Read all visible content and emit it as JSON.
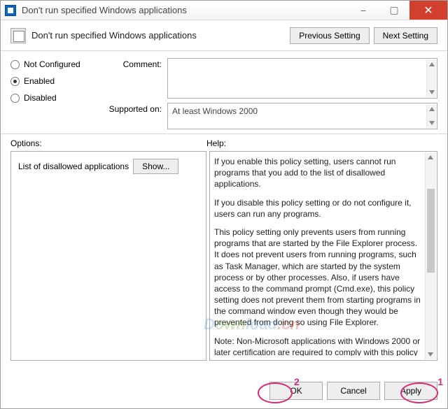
{
  "window": {
    "title": "Don't run specified Windows applications",
    "controls": {
      "min": "−",
      "max": "▢",
      "close": "✕"
    }
  },
  "header": {
    "title": "Don't run specified Windows applications",
    "prev": "Previous Setting",
    "next": "Next Setting"
  },
  "radios": {
    "notConfigured": "Not Configured",
    "enabled": "Enabled",
    "disabled": "Disabled",
    "selected": "enabled"
  },
  "mid": {
    "commentLabel": "Comment:",
    "supportedLabel": "Supported on:",
    "supportedText": "At least Windows 2000"
  },
  "labels": {
    "options": "Options:",
    "help": "Help:"
  },
  "options": {
    "listLabel": "List of disallowed applications",
    "showBtn": "Show..."
  },
  "help": {
    "p1": "If you enable this policy setting, users cannot run programs that you add to the list of disallowed applications.",
    "p2": "If you disable this policy setting or do not configure it, users can run any programs.",
    "p3": "This policy setting only prevents users from running programs that are started by the File Explorer process. It does not prevent users from running programs, such as Task Manager, which are started by the system process or by other processes.  Also, if users have access to the command prompt (Cmd.exe), this policy setting does not prevent them from starting programs in the command window even though they would be prevented from doing so using File Explorer.",
    "p4": "Note: Non-Microsoft applications with Windows 2000 or later certification are required to comply with this policy setting.\nNote: To create a list of allowed applications, click Show.  In the Show Contents dialog box, in the Value column, type the application executable name (e.g., Winword.exe, Poledit.exe, Powerpnt.exe)."
  },
  "buttons": {
    "ok": "OK",
    "cancel": "Cancel",
    "apply": "Apply"
  },
  "annotations": {
    "num1": "1",
    "num2": "2"
  },
  "watermark": {
    "a": "D",
    "b": "own",
    "c": "load",
    "d": ".cn"
  }
}
